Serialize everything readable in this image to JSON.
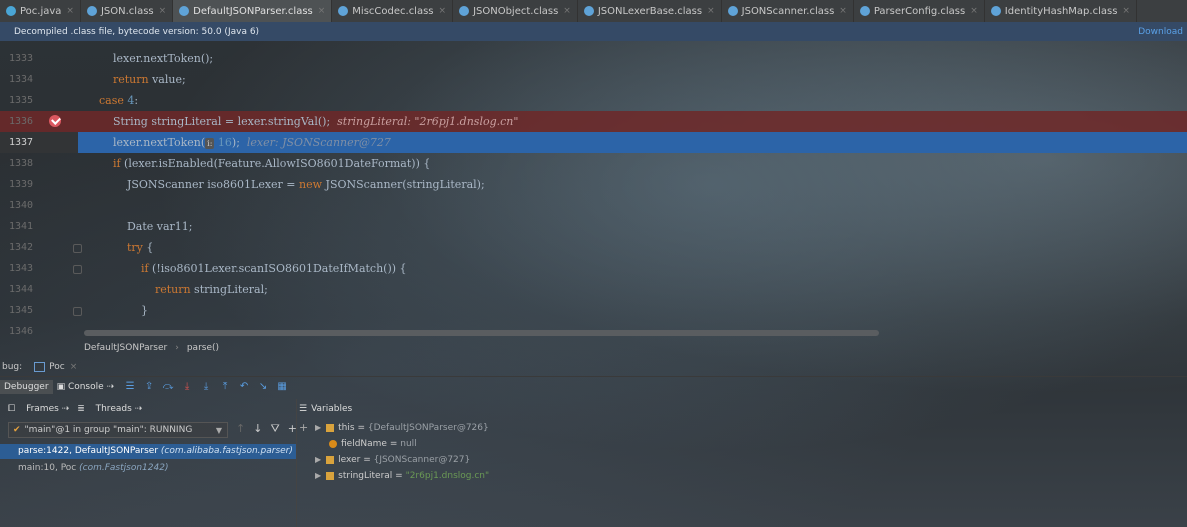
{
  "tabs": [
    {
      "label": "Poc.java",
      "icon": "java-class-icon",
      "active": false
    },
    {
      "label": "JSON.class",
      "icon": "class-file-icon",
      "active": false
    },
    {
      "label": "DefaultJSONParser.class",
      "icon": "class-file-icon",
      "active": true
    },
    {
      "label": "MiscCodec.class",
      "icon": "class-file-icon",
      "active": false
    },
    {
      "label": "JSONObject.class",
      "icon": "class-file-icon",
      "active": false
    },
    {
      "label": "JSONLexerBase.class",
      "icon": "class-file-icon",
      "active": false
    },
    {
      "label": "JSONScanner.class",
      "icon": "class-file-icon",
      "active": false
    },
    {
      "label": "ParserConfig.class",
      "icon": "class-file-icon",
      "active": false
    },
    {
      "label": "IdentityHashMap.class",
      "icon": "class-file-icon",
      "active": false
    }
  ],
  "banner": {
    "text": "Decompiled .class file, bytecode version: 50.0 (Java 6)",
    "link": "Download"
  },
  "editor": {
    "line_numbers": [
      "1333",
      "1334",
      "1335",
      "1336",
      "1337",
      "1338",
      "1339",
      "1340",
      "1341",
      "1342",
      "1343",
      "1344",
      "1345",
      "1346"
    ],
    "lines": {
      "l1333": "lexer.nextToken();",
      "l1334_kw": "return",
      "l1334": " value;",
      "l1335_kw": "case",
      "l1335_num": " 4",
      "l1335": ":",
      "l1336": "String stringLiteral = lexer.stringVal();",
      "l1336_hint": "stringLiteral: \"2r6pj1.dnslog.cn\"",
      "l1337_a": "lexer.nextToken(",
      "l1337_badge": "i:",
      "l1337_num": " 16",
      "l1337_b": ");",
      "l1337_hint": "lexer: JSONScanner@727",
      "l1338_kw": "if",
      "l1338": " (lexer.isEnabled(Feature.AllowISO8601DateFormat)) {",
      "l1339_a": "JSONScanner iso8601Lexer = ",
      "l1339_kw": "new",
      "l1339_b": " JSONScanner(stringLiteral);",
      "l1341": "Date var11;",
      "l1342_kw": "try",
      "l1342": " {",
      "l1343_kw": "if",
      "l1343": " (!iso8601Lexer.scanISO8601DateIfMatch()) {",
      "l1344_kw": "return",
      "l1344": " stringLiteral;",
      "l1345": "}"
    }
  },
  "breadcrumb": {
    "class": "DefaultJSONParser",
    "method": "parse()"
  },
  "debug": {
    "label": "bug:",
    "config": "Poc",
    "tabs": {
      "debugger": "Debugger",
      "console": "Console"
    },
    "frames_label": "Frames",
    "threads_label": "Threads",
    "variables_label": "Variables",
    "thread": "\"main\"@1 in group \"main\": RUNNING",
    "frames": [
      {
        "method": "parse:1422, DefaultJSONParser",
        "pkg": "(com.alibaba.fastjson.parser)",
        "selected": true
      },
      {
        "method": "main:10, Poc",
        "pkg": "(com.Fastjson1242)",
        "selected": false
      }
    ],
    "variables": [
      {
        "name": "this",
        "eq": " = ",
        "value": "{DefaultJSONParser@726}",
        "expandable": true,
        "kind": "object"
      },
      {
        "name": "fieldName",
        "eq": " = ",
        "value": "null",
        "expandable": false,
        "kind": "field"
      },
      {
        "name": "lexer",
        "eq": " = ",
        "value": "{JSONScanner@727}",
        "expandable": true,
        "kind": "object"
      },
      {
        "name": "stringLiteral",
        "eq": " = ",
        "value": "\"2r6pj1.dnslog.cn\"",
        "expandable": true,
        "kind": "string"
      }
    ]
  },
  "colors": {
    "selection": "#2c64a8",
    "breakpoint_line": "#6e2828",
    "keyword": "#cc7832",
    "number": "#6897bb"
  }
}
